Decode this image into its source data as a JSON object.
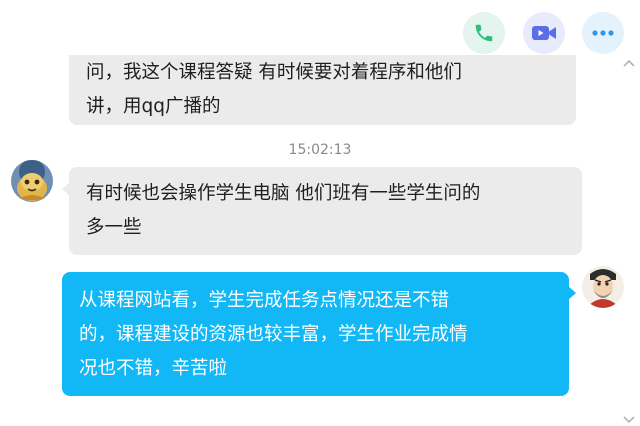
{
  "toolbar": {
    "call_icon": "phone-icon",
    "video_icon": "video-camera-icon",
    "more_icon": "more-dots-icon",
    "call_color": "#2dbe7c",
    "video_color": "#5b6ee8",
    "more_color": "#2f97e8"
  },
  "messages": [
    {
      "direction": "incoming",
      "lines": [
        "问，我这个课程答疑 有时候要对着程序和他们",
        "讲，用qq广播的"
      ]
    },
    {
      "direction": "incoming",
      "lines": [
        "有时候也会操作学生电脑 他们班有一些学生问的",
        "多一些"
      ]
    },
    {
      "direction": "outgoing",
      "lines": [
        "从课程网站看，学生完成任务点情况还是不错",
        "的，课程建设的资源也较丰富，学生作业完成情",
        "况也不错，辛苦啦"
      ]
    }
  ],
  "timestamp": "15:02:13",
  "colors": {
    "incoming_bubble": "#ebebeb",
    "outgoing_bubble": "#12b7f5",
    "background": "#ffffff"
  }
}
